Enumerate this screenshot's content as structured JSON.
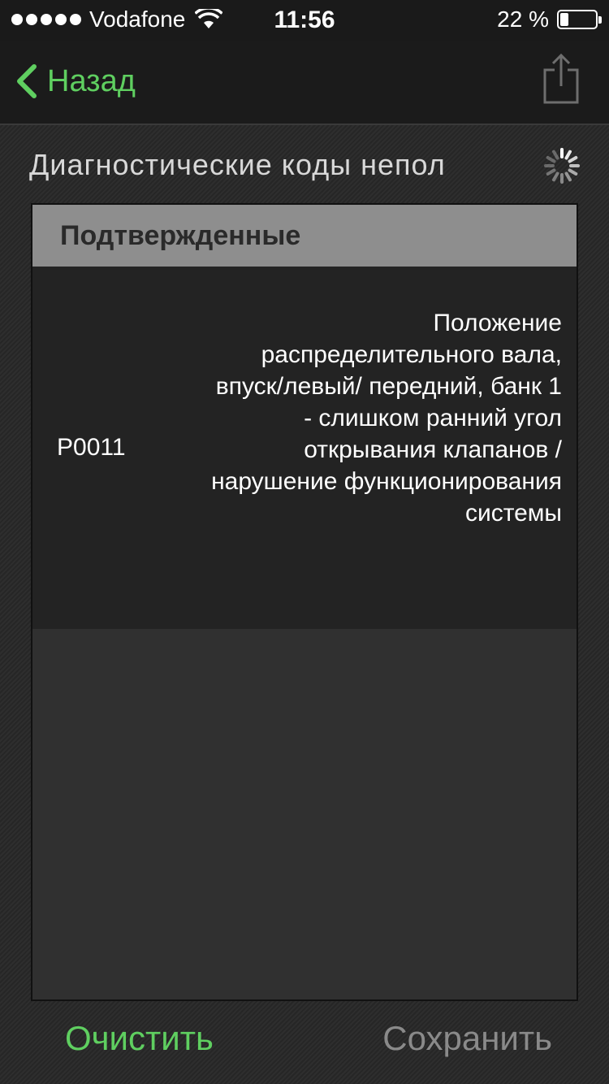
{
  "status": {
    "carrier": "Vodafone",
    "time": "11:56",
    "battery_text": "22 %",
    "battery_level": 0.22
  },
  "nav": {
    "back_label": "Назад",
    "share_icon": "share-icon"
  },
  "title": "Диагностические коды непол",
  "section": {
    "header": "Подтвержденные",
    "codes": [
      {
        "code": "P0011",
        "description": "Положение распределительного вала, впуск/левый/ передний, банк 1 - слишком ранний угол открывания клапанов / нарушение функционирования системы"
      }
    ]
  },
  "buttons": {
    "clear": "Очистить",
    "save": "Сохранить"
  },
  "colors": {
    "accent": "#5fcf60",
    "disabled": "#8a8a8a",
    "header_bg": "#8e8e8e"
  }
}
